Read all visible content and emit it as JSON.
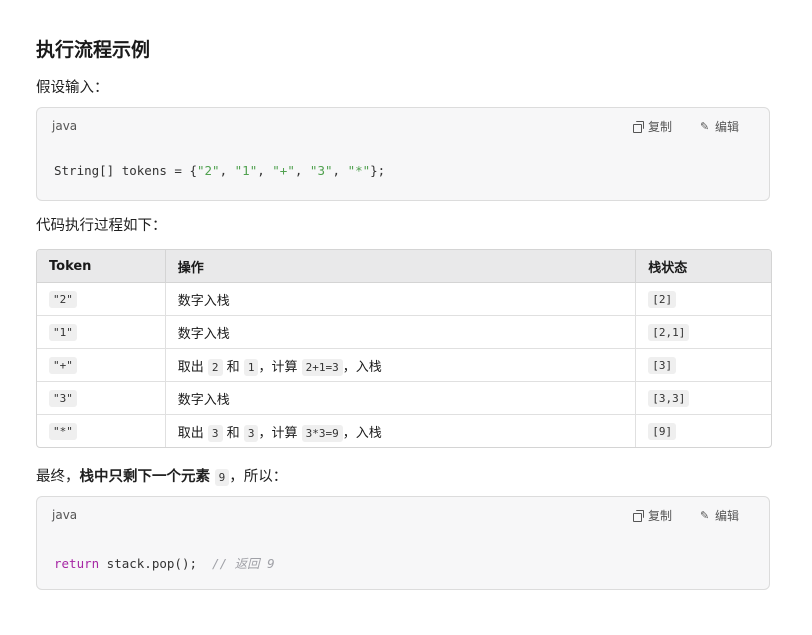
{
  "heading": "执行流程示例",
  "intro": "假设输入：",
  "code_block_1": {
    "language": "java",
    "copy_label": "复制",
    "edit_label": "编辑",
    "code": {
      "prefix": "String[] tokens = {",
      "s1": "\"2\"",
      "sep1": ", ",
      "s2": "\"1\"",
      "sep2": ", ",
      "s3": "\"+\"",
      "sep3": ", ",
      "s4": "\"3\"",
      "sep4": ", ",
      "s5": "\"*\"",
      "suffix": "};"
    }
  },
  "process_intro": "代码执行过程如下：",
  "table": {
    "headers": [
      "Token",
      "操作",
      "栈状态"
    ],
    "rows": [
      {
        "token": "\"2\"",
        "op_text": "数字入栈",
        "stack": "[2]"
      },
      {
        "token": "\"1\"",
        "op_text": "数字入栈",
        "stack": "[2,1]"
      },
      {
        "token": "\"+\"",
        "op_pre": "取出",
        "op_a": "2",
        "op_and": "和",
        "op_b": "1",
        "op_mid": "，计算",
        "op_expr": "2+1=3",
        "op_post": "，入栈",
        "stack": "[3]"
      },
      {
        "token": "\"3\"",
        "op_text": "数字入栈",
        "stack": "[3,3]"
      },
      {
        "token": "\"*\"",
        "op_pre": "取出",
        "op_a": "3",
        "op_and": "和",
        "op_b": "3",
        "op_mid": "，计算",
        "op_expr": "3*3=9",
        "op_post": "，入栈",
        "stack": "[9]"
      }
    ]
  },
  "final": {
    "pre": "最终，",
    "bold": "栈中只剩下一个元素",
    "value": "9",
    "post": "，所以："
  },
  "code_block_2": {
    "language": "java",
    "copy_label": "复制",
    "edit_label": "编辑",
    "code": {
      "keyword": "return",
      "body": " stack.pop();  ",
      "comment": "// 返回 9"
    }
  }
}
